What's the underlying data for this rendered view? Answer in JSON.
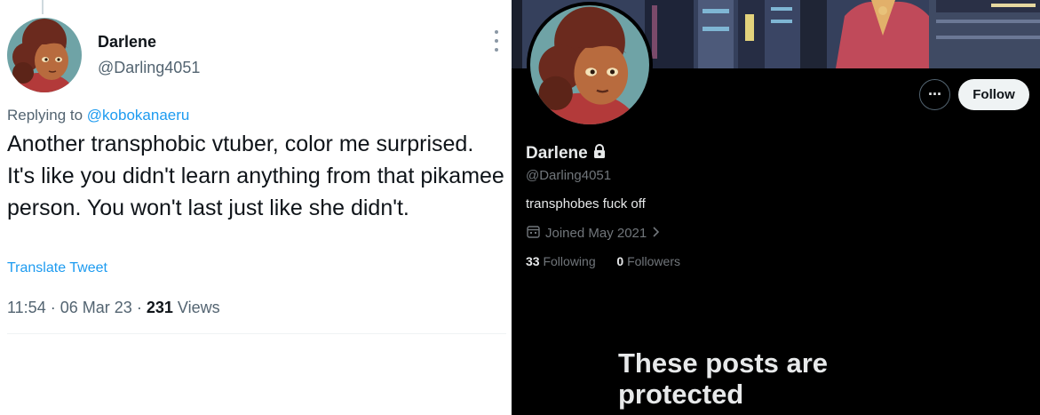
{
  "tweet": {
    "author_name": "Darlene",
    "author_handle": "@Darling4051",
    "replying_prefix": "Replying to",
    "replying_to": "@kobokanaeru",
    "text": "Another transphobic vtuber, color me surprised. It's like you didn't learn anything from that pikamee person. You won't last just like she didn't.",
    "translate_label": "Translate Tweet",
    "time": "11:54",
    "separator": "·",
    "date": "06 Mar 23",
    "views_count": "231",
    "views_label": "Views"
  },
  "profile": {
    "name": "Darlene",
    "handle": "@Darling4051",
    "bio": "transphobes fuck off",
    "joined": "Joined May 2021",
    "following_count": "33",
    "following_label": "Following",
    "followers_count": "0",
    "followers_label": "Followers",
    "more_label": "···",
    "follow_label": "Follow",
    "protected_message": "These posts are protected"
  },
  "icons": {
    "more": "more-vertical-icon",
    "lock": "lock-icon",
    "calendar": "calendar-icon",
    "chevron": "chevron-right-icon"
  },
  "colors": {
    "link_blue": "#1d9bf0",
    "text_dark": "#0f1419",
    "text_gray": "#536471",
    "dark_bg": "#000000"
  }
}
